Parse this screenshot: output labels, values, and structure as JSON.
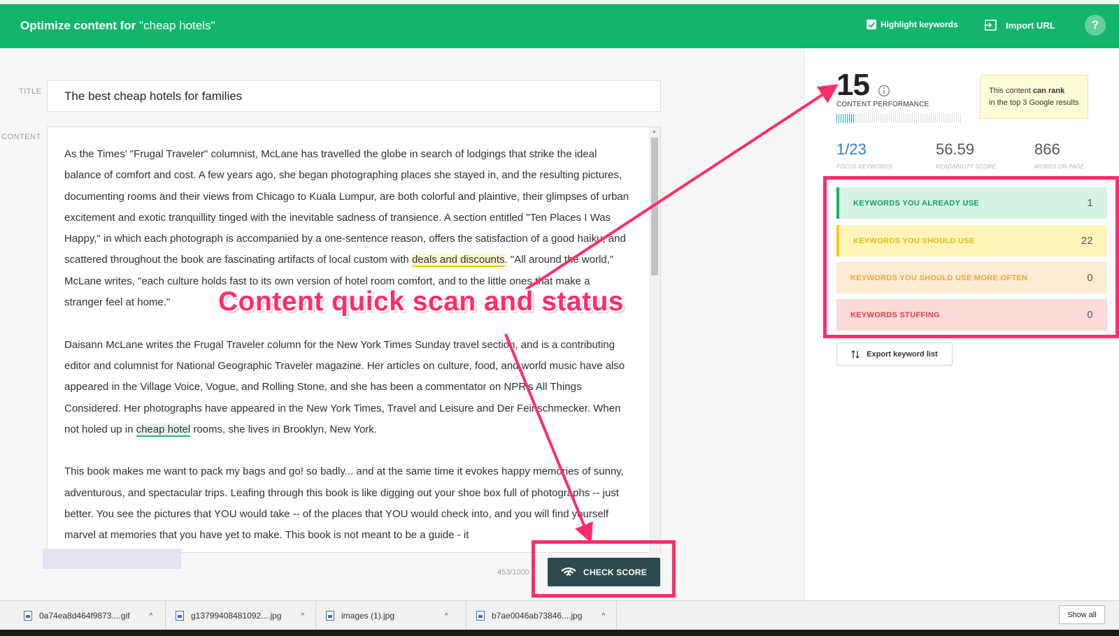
{
  "header": {
    "title_bold": "Optimize content for",
    "title_query": "\"cheap hotels\"",
    "highlight_label": "Highlight keywords",
    "highlight_checked": true,
    "import_label": "Import URL",
    "help_label": "?"
  },
  "editor": {
    "title_label": "TITLE",
    "title_value": "The best cheap hotels for families",
    "content_label": "CONTENT",
    "p1_a": "As the Times' \"Frugal Traveler\" columnist, McLane has travelled the globe in search of lodgings that strike the ideal balance of comfort and cost. A few years ago, she began photographing places she stayed in, and the resulting pictures, documenting rooms and their views from Chicago to Kuala Lumpur, are both colorful and plaintive, their glimpses of urban excitement and exotic tranquillity tinged with the inevitable sadness of transience. A section entitled \"Ten Places I Was Happy,\" in which each photograph is accompanied by a one-sentence reason, offers the satisfaction of a good haiku, and scattered throughout the book are fascinating artifacts of local custom with ",
    "p1_kw": "deals and discounts",
    "p1_b": ". \"All around the world,\" McLane writes, \"each culture holds fast to its own version of hotel room comfort, and to the little ones that make a stranger feel at home.\"",
    "p2_a": "Daisann McLane writes the Frugal Traveler column for the New York Times Sunday travel section, and is a contributing editor and columnist for National Geographic Traveler magazine. Her articles on culture, food, and world music have also appeared in the Village Voice, Vogue, and Rolling Stone, and she has been a commentator on NPR's All Things Considered. Her photographs have appeared in the New York Times, Travel and Leisure and Der Feinschmecker. When not holed up in ",
    "p2_kw": "cheap hotel",
    "p2_b": "  rooms, she lives in Brooklyn, New York.",
    "p3": "This book makes me want to pack my bags and go! so badly... and at the same time it evokes happy memories of sunny, adventurous, and spectacular trips. Leafing through this book is like digging out your shoe box full of photographs -- just better. You see the pictures that YOU would take -- of the places that YOU would check into, and you will find yourself marvel at memories that you have yet to make. This book is not meant to be a guide - it",
    "counter": "453/1000",
    "check_score_label": "CHECK SCORE"
  },
  "panel": {
    "score": "15",
    "performance_label": "CONTENT PERFORMANCE",
    "performance_fraction": 0.15,
    "tooltip_pre": "This content ",
    "tooltip_bold": "can rank",
    "tooltip_line2": "in the top 3 Google results",
    "stats": [
      {
        "value": "1/23",
        "label": "FOCUS KEYWORDS"
      },
      {
        "value": "56.59",
        "label": "READABILITY SCORE"
      },
      {
        "value": "866",
        "label": "WORDS ON PAGE"
      }
    ],
    "keywords": [
      {
        "label": "KEYWORDS YOU ALREADY USE",
        "count": "1"
      },
      {
        "label": "KEYWORDS YOU SHOULD USE",
        "count": "22"
      },
      {
        "label": "KEYWORDS YOU SHOULD USE MORE OFTEN",
        "count": "0"
      },
      {
        "label": "KEYWORDS STUFFING",
        "count": "0"
      }
    ],
    "export_label": "Export keyword list"
  },
  "annotation": {
    "text": "Content quick scan and status"
  },
  "downloads": {
    "items": [
      "0a74ea8d464f9873....gif",
      "g13799408481092....jpg",
      "images (1).jpg",
      "b7ae0046ab73846....jpg"
    ],
    "show_all": "Show all"
  },
  "colors": {
    "brand_green": "#12b56a",
    "annotation_pink": "#ff2c6a",
    "check_button": "#2d4a4e"
  }
}
